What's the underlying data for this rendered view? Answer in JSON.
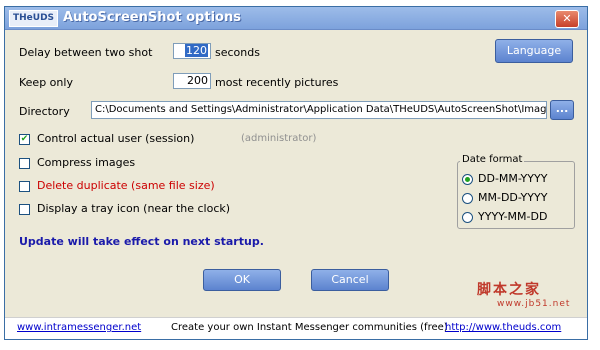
{
  "window": {
    "logo": "THeUDS",
    "title": "AutoScreenShot options",
    "close_glyph": "✕"
  },
  "delay": {
    "label": "Delay between two shot",
    "value": "120",
    "unit": "seconds"
  },
  "keep": {
    "label": "Keep only",
    "value": "200",
    "unit": "most recently pictures"
  },
  "language_button": "Language",
  "directory": {
    "label": "Directory",
    "value": "C:\\Documents and Settings\\Administrator\\Application Data\\THeUDS\\AutoScreenShot\\Images",
    "browse": "..."
  },
  "options": [
    {
      "label": "Control actual user (session)",
      "checked": true,
      "note": "(administrator)"
    },
    {
      "label": "Compress images",
      "checked": false
    },
    {
      "label": "Delete duplicate (same file size)",
      "checked": false
    },
    {
      "label": "Display a tray icon (near the clock)",
      "checked": false
    }
  ],
  "date_format": {
    "title": "Date format",
    "options": [
      "DD-MM-YYYY",
      "MM-DD-YYYY",
      "YYYY-MM-DD"
    ],
    "selected": "DD-MM-YYYY"
  },
  "notice": "Update will take effect on next startup.",
  "ok_button": "OK",
  "cancel_button": "Cancel",
  "footer": {
    "left_link": "www.intramessenger.net",
    "tagline": "Create your own Instant Messenger communities (free)",
    "right_link": "http://www.theuds.com"
  },
  "watermark": {
    "cn": "脚本之家",
    "url": "www.jb51.net"
  },
  "colors": {
    "accent": "#316ac5",
    "delete_red": "#cc0000",
    "notice_blue": "#1a1aaa",
    "note_gray": "#909090"
  }
}
